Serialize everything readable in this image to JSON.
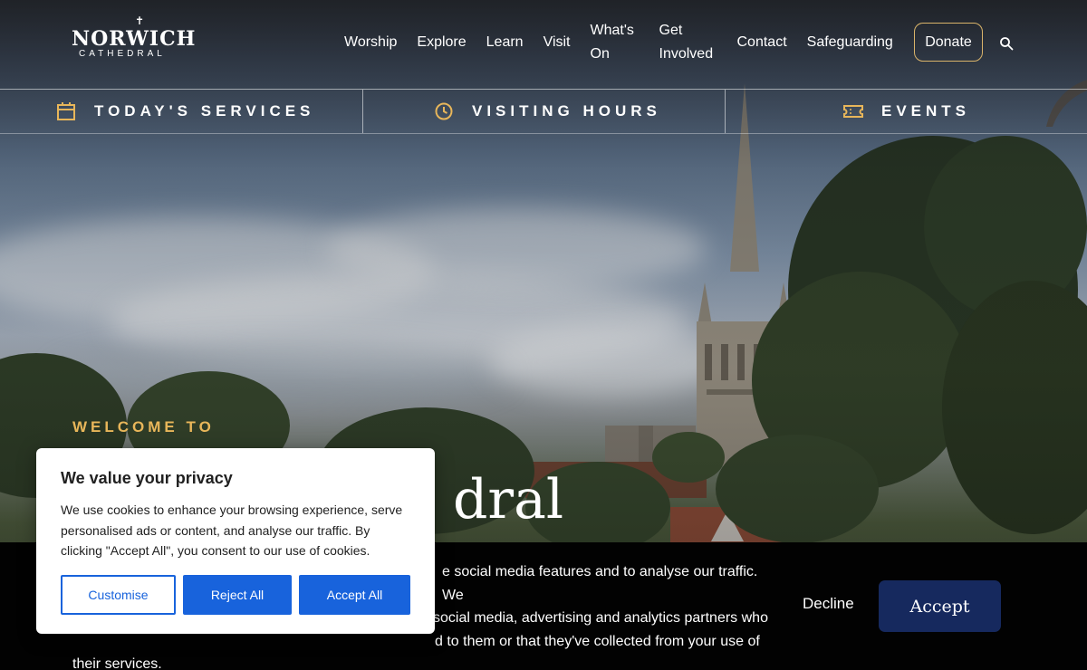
{
  "logo": {
    "main": "NORWICH",
    "sub": "CATHEDRAL"
  },
  "nav": {
    "items": [
      "Worship",
      "Explore",
      "Learn",
      "Visit",
      "What's On",
      "Get Involved",
      "Contact",
      "Safeguarding"
    ],
    "donate_label": "Donate",
    "accent_color": "#d9b36a"
  },
  "quick_links": [
    {
      "label": "TODAY'S SERVICES",
      "icon": "calendar-icon"
    },
    {
      "label": "VISITING HOURS",
      "icon": "clock-icon"
    },
    {
      "label": "EVENTS",
      "icon": "ticket-icon"
    }
  ],
  "hero": {
    "welcome": "WELCOME TO",
    "title_visible": "dral"
  },
  "cookie_bar": {
    "text": "e social media features and to analyse our traffic. We social media, advertising and analytics partners who d to them or that they've collected from your use of their services.",
    "line1": "e social media features and to analyse our traffic. We",
    "line2": "social media, advertising and analytics partners who",
    "line3": "d to them or that they've collected from your use of",
    "line4": "their services.",
    "decline_label": "Decline",
    "accept_label": "Accept",
    "accept_color": "#16295e"
  },
  "privacy_modal": {
    "title": "We value your privacy",
    "body": "We use cookies to enhance your browsing experience, serve personalised ads or content, and analyse our traffic. By clicking \"Accept All\", you consent to our use of cookies.",
    "customise_label": "Customise",
    "reject_label": "Reject All",
    "accept_all_label": "Accept All",
    "button_color": "#1863dc"
  }
}
